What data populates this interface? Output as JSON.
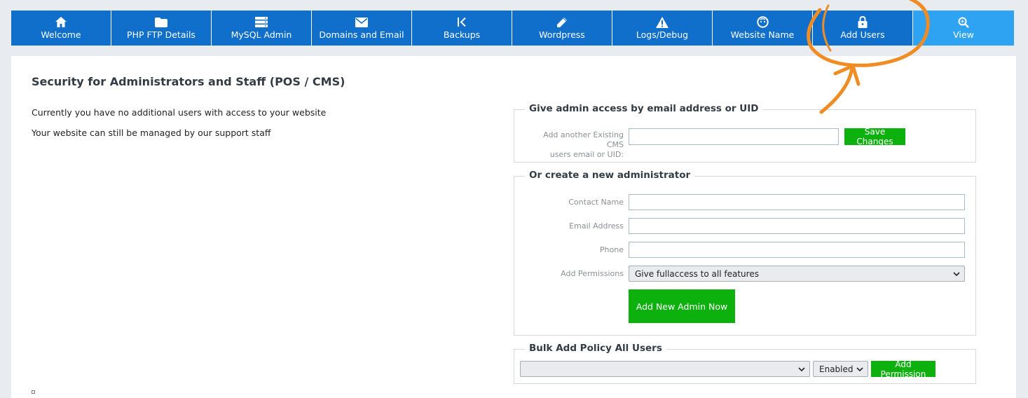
{
  "nav": {
    "items": [
      {
        "label": "Welcome",
        "icon": "home-icon"
      },
      {
        "label": "PHP FTP Details",
        "icon": "folder-icon"
      },
      {
        "label": "MySQL Admin",
        "icon": "database-icon"
      },
      {
        "label": "Domains and Email",
        "icon": "envelope-icon"
      },
      {
        "label": "Backups",
        "icon": "backup-icon"
      },
      {
        "label": "Wordpress",
        "icon": "pencil-icon"
      },
      {
        "label": "Logs/Debug",
        "icon": "warning-icon"
      },
      {
        "label": "Website Name",
        "icon": "face-icon"
      },
      {
        "label": "Add Users",
        "icon": "lock-icon"
      },
      {
        "label": "View",
        "icon": "zoom-icon"
      }
    ],
    "active_color": "#0f6fca",
    "highlight_color": "#2ea3f2"
  },
  "page": {
    "title": "Security for Administrators and Staff (POS / CMS)",
    "info_line_1": "Currently you have no additional users with access to your website",
    "info_line_2": "Your website can still be managed by our support staff"
  },
  "existing": {
    "legend": "Give admin access by email address or UID",
    "label_line_1": "Add another Existing CMS",
    "label_line_2": "users email or UID:",
    "value": "",
    "save_label": "Save Changes"
  },
  "create": {
    "legend": "Or create a new administrator",
    "contact_label": "Contact Name",
    "email_label": "Email Address",
    "phone_label": "Phone",
    "permissions_label": "Add Permissions",
    "permissions_selected": "Give fullaccess to all features",
    "submit_label": "Add New Admin Now"
  },
  "bulk": {
    "legend": "Bulk Add Policy All Users",
    "policy_selected": "",
    "status_selected": "Enabled",
    "add_label": "Add Permission"
  },
  "colors": {
    "green": "#0db10d",
    "annotation": "#f08c24"
  }
}
